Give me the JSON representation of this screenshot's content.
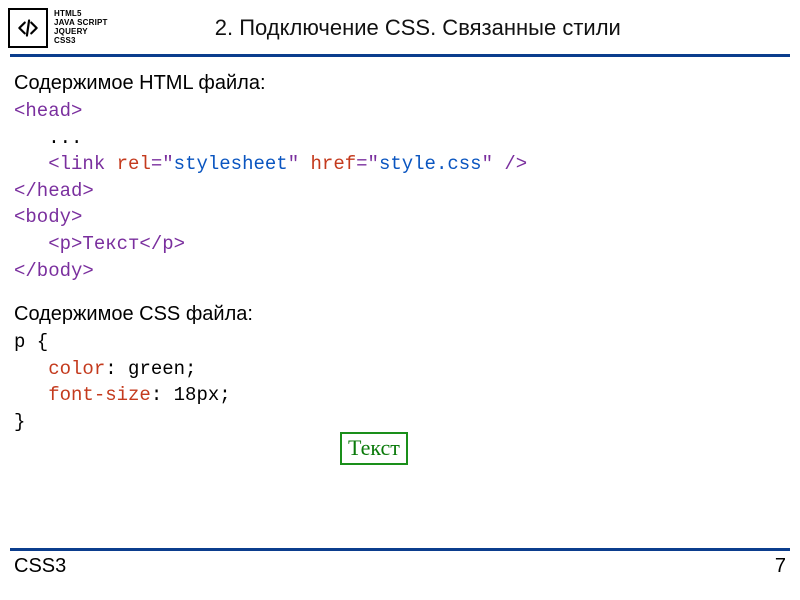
{
  "logo": {
    "lines": [
      "HTML5",
      "JAVA SCRIPT",
      "JQUERY",
      "CSS3"
    ]
  },
  "header": {
    "title": "2. Подключение CSS. Связанные стили"
  },
  "content": {
    "html_label": "Содержимое HTML файла:",
    "css_label": "Содержимое CSS файла:",
    "html_code": {
      "head_open": "<head>",
      "dots": "   ...",
      "indent": "   ",
      "lt": "<",
      "link": "link ",
      "rel": "rel",
      "eq_q": "=\"",
      "rel_val": "stylesheet",
      "sep": "\" ",
      "href": "href",
      "href_val": "style.css",
      "close_self": "\" />",
      "head_close": "</head>",
      "body_open": "<body>",
      "p_line": "   <p>Текст</p>",
      "body_close": "</body>"
    },
    "css_code": {
      "l1": "p {",
      "prop1": "color",
      "val1": ": green;",
      "prop2": "font-size",
      "val2": ": 18px;",
      "l4": "}",
      "indent": "   "
    },
    "result_text": "Текст"
  },
  "footer": {
    "left": "CSS3",
    "right": "7"
  }
}
